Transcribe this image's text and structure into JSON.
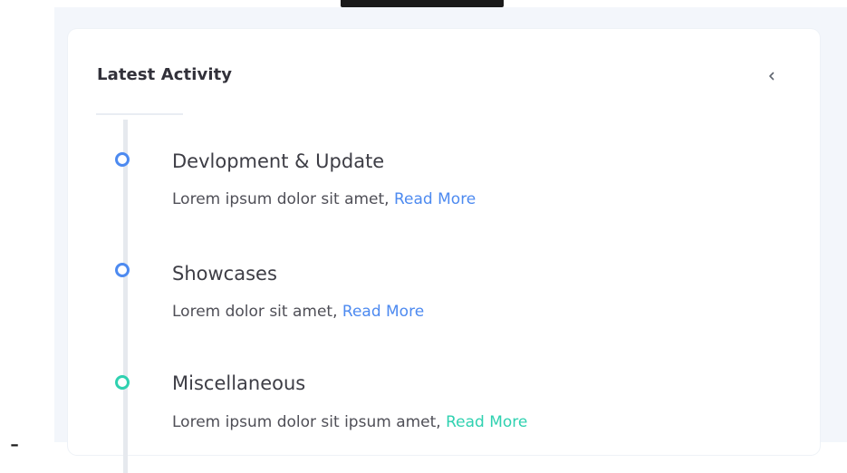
{
  "card": {
    "title": "Latest Activity"
  },
  "timeline": [
    {
      "heading": "Devlopment & Update",
      "text": "Lorem ipsum dolor sit amet, ",
      "link": "Read More",
      "color": "#4d8af0"
    },
    {
      "heading": "Showcases",
      "text": "Lorem dolor sit amet, ",
      "link": "Read More",
      "color": "#4d8af0"
    },
    {
      "heading": "Miscellaneous",
      "text": "Lorem ipsum dolor sit ipsum amet, ",
      "link": "Read More",
      "color": "#2fd1b0"
    }
  ],
  "footer": {
    "dash": "-"
  },
  "icons": {
    "collapse": "chevron-left-icon"
  },
  "colors": {
    "accent_blue": "#4d8af0",
    "accent_teal": "#2fd1b0",
    "page_bg": "#f3f6fb"
  }
}
